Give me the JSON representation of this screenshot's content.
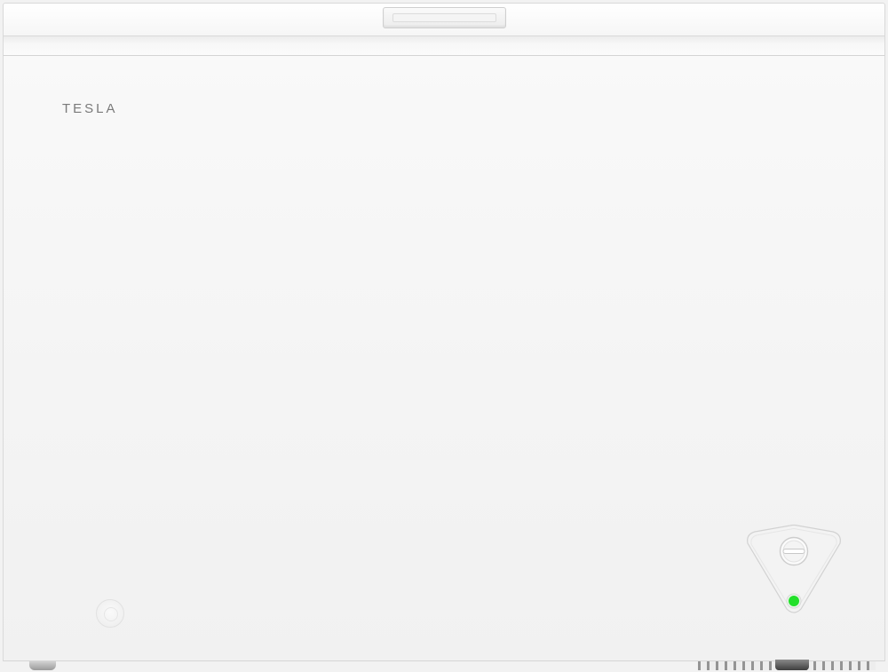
{
  "brand": {
    "logo_text": "TESLA"
  },
  "control_panel": {
    "thermostat_knob": "thermostat-knob-icon",
    "power_indicator": {
      "state": "on",
      "color": "#22e02a"
    }
  },
  "colors": {
    "body": "#f4f4f4",
    "logo": "#7a7a7a",
    "indicator": "#22e02a"
  }
}
